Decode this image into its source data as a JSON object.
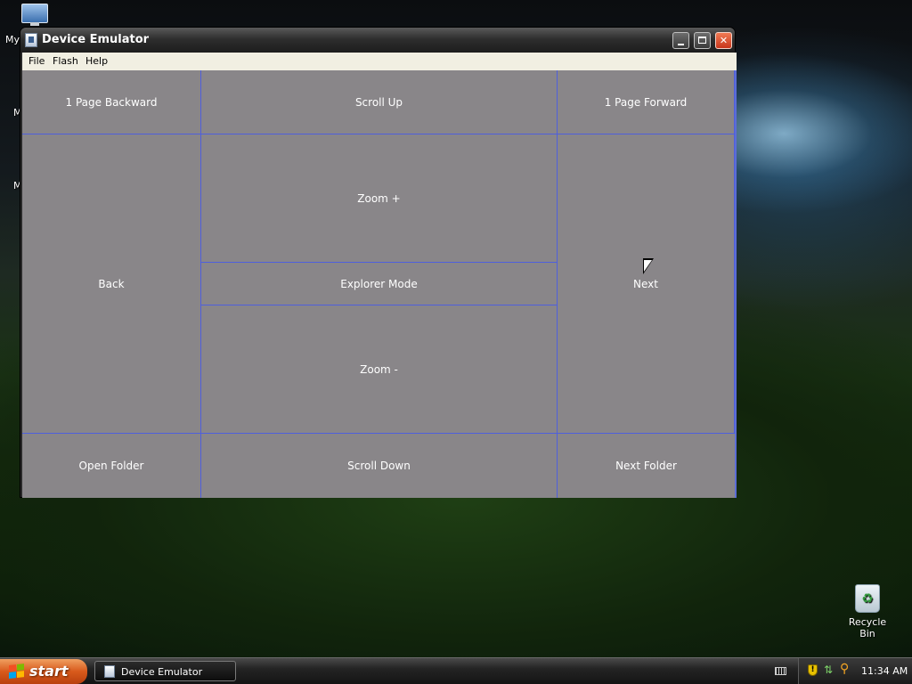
{
  "desktop": {
    "my_computer_fragment": "My",
    "fragment_1": "M",
    "fragment_2": "M",
    "recycle_bin_label": "Recycle Bin"
  },
  "window": {
    "title": "Device Emulator",
    "icon": "device-emulator-icon",
    "controls": [
      "minimize-icon",
      "maximize-icon",
      "close-icon"
    ],
    "close_glyph": "✕"
  },
  "menu": {
    "items": [
      "File",
      "Flash",
      "Help"
    ]
  },
  "zones": {
    "page_backward": "1 Page Backward",
    "scroll_up": "Scroll Up",
    "page_forward": "1 Page Forward",
    "back": "Back",
    "zoom_in": "Zoom +",
    "explorer_mode": "Explorer Mode",
    "zoom_out": "Zoom -",
    "next": "Next",
    "open_folder": "Open Folder",
    "scroll_down": "Scroll Down",
    "next_folder": "Next Folder"
  },
  "taskbar": {
    "start_label": "start",
    "task_item": "Device Emulator",
    "clock": "11:34 AM",
    "tray_icons": [
      "security-shield-icon",
      "network-icon",
      "search-icon"
    ]
  },
  "colors": {
    "client_background": "#898689",
    "zone_border": "#4f5fdc",
    "start_button": "#d85a1c",
    "close_button": "#c8361b"
  }
}
